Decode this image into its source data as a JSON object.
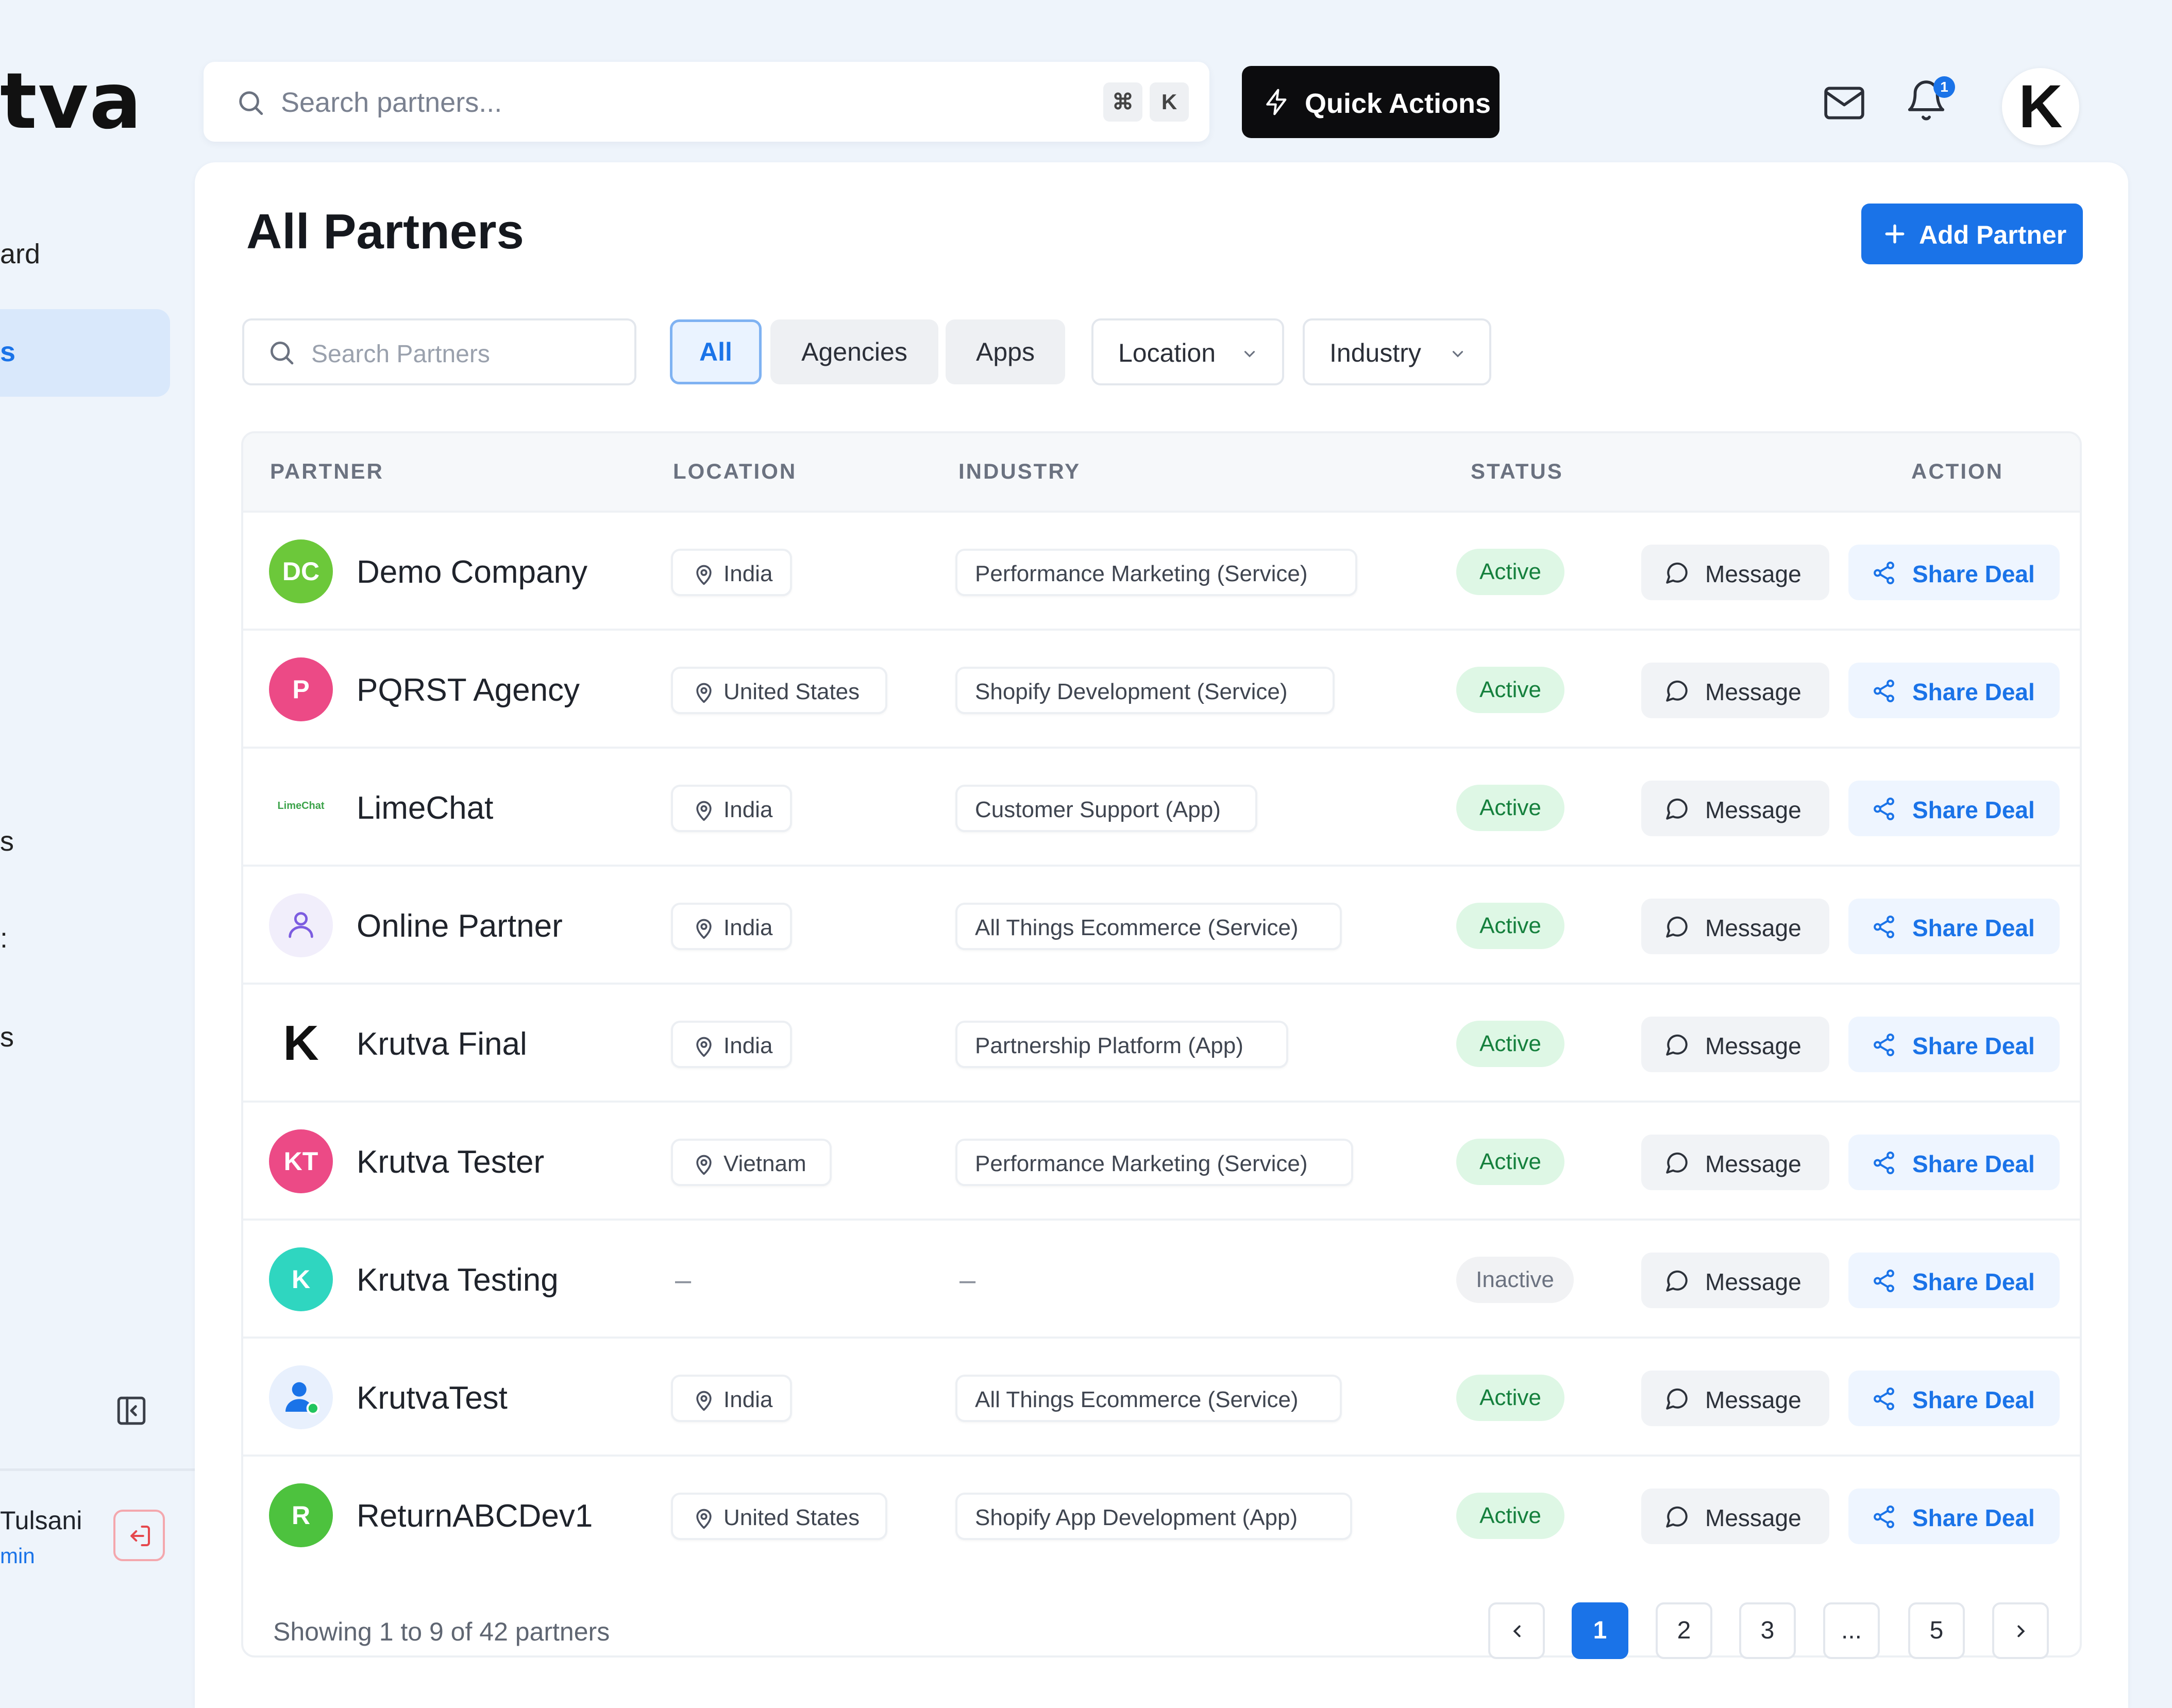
{
  "brand": {
    "logo_text": "tva"
  },
  "sidebar": {
    "items": [
      {
        "label": "ard"
      },
      {
        "label": "s"
      },
      {
        "label": "s"
      },
      {
        "label": ":"
      },
      {
        "label": "s"
      }
    ],
    "user": {
      "name": "Tulsani",
      "role": "min"
    }
  },
  "topbar": {
    "search_placeholder": "Search partners...",
    "shortcut_cmd": "⌘",
    "shortcut_key": "K",
    "quick_actions_label": "Quick Actions",
    "notification_count": "1",
    "avatar_letter": "K"
  },
  "page": {
    "title": "All Partners",
    "add_button_label": "Add Partner"
  },
  "filters": {
    "search_placeholder": "Search Partners",
    "tabs": [
      {
        "label": "All",
        "active": true
      },
      {
        "label": "Agencies",
        "active": false
      },
      {
        "label": "Apps",
        "active": false
      }
    ],
    "location_label": "Location",
    "industry_label": "Industry"
  },
  "table": {
    "headers": {
      "partner": "PARTNER",
      "location": "LOCATION",
      "industry": "INDUSTRY",
      "status": "STATUS",
      "action": "ACTION"
    },
    "message_label": "Message",
    "share_label": "Share Deal",
    "rows": [
      {
        "name": "Demo Company",
        "initials": "DC",
        "avatar_color": "#6cc83a",
        "location": "India",
        "industry": "Performance Marketing (Service)",
        "status": "Active"
      },
      {
        "name": "PQRST Agency",
        "initials": "P",
        "avatar_color": "#ec4a86",
        "location": "United States",
        "industry": "Shopify Development (Service)",
        "status": "Active"
      },
      {
        "name": "LimeChat",
        "initials": "LimeChat",
        "avatar_color": "#ffffff",
        "location": "India",
        "industry": "Customer Support (App)",
        "status": "Active"
      },
      {
        "name": "Online Partner",
        "initials": "",
        "avatar_color": "#f1eefb",
        "location": "India",
        "industry": "All Things Ecommerce (Service)",
        "status": "Active"
      },
      {
        "name": "Krutva Final",
        "initials": "K",
        "avatar_color": "#ffffff",
        "location": "India",
        "industry": "Partnership Platform (App)",
        "status": "Active"
      },
      {
        "name": "Krutva Tester",
        "initials": "KT",
        "avatar_color": "#ec4a86",
        "location": "Vietnam",
        "industry": "Performance Marketing (Service)",
        "status": "Active"
      },
      {
        "name": "Krutva Testing",
        "initials": "K",
        "avatar_color": "#2fd6c0",
        "location": "–",
        "industry": "–",
        "status": "Inactive"
      },
      {
        "name": "KrutvaTest",
        "initials": "",
        "avatar_color": "#e8f0fd",
        "location": "India",
        "industry": "All Things Ecommerce (Service)",
        "status": "Active"
      },
      {
        "name": "ReturnABCDev1",
        "initials": "R",
        "avatar_color": "#4dc23e",
        "location": "United States",
        "industry": "Shopify App Development (App)",
        "status": "Active"
      }
    ]
  },
  "pagination": {
    "summary": "Showing 1 to 9 of 42 partners",
    "pages": [
      "1",
      "2",
      "3",
      "...",
      "5"
    ],
    "current": "1"
  },
  "colors": {
    "accent": "#1a73e8",
    "active_bg": "#def7e5",
    "active_text": "#15803d"
  }
}
